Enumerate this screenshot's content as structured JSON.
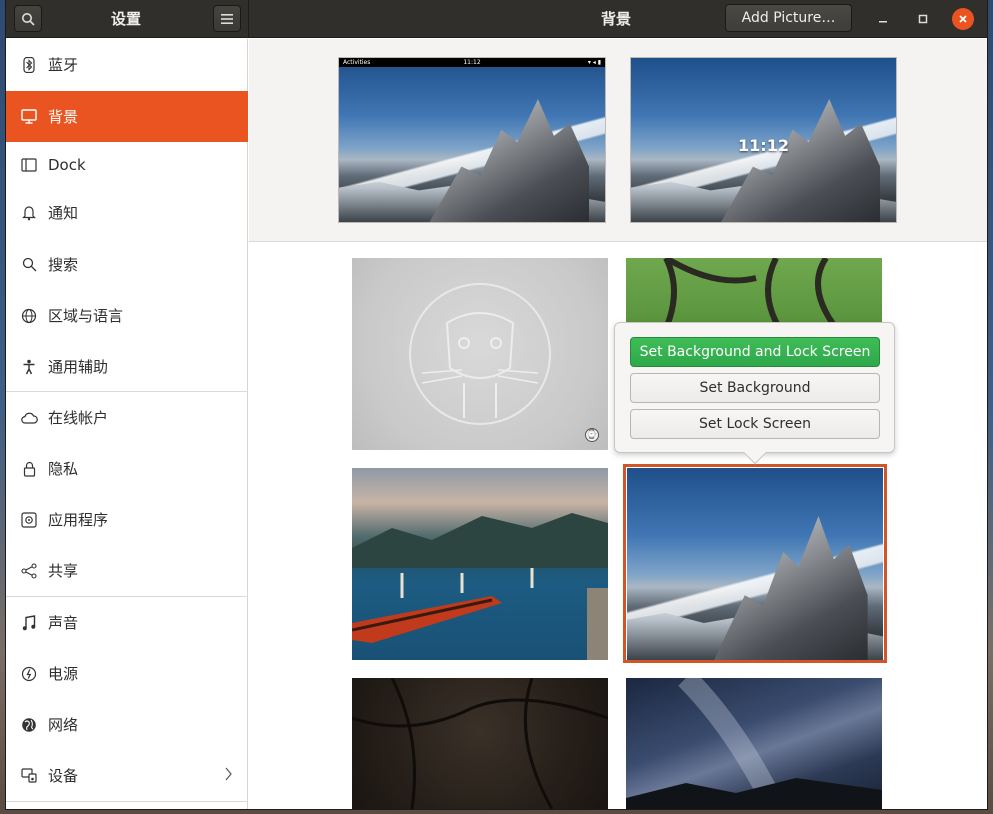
{
  "header": {
    "sidebar_title": "设置",
    "main_title": "背景",
    "add_picture_label": "Add Picture…"
  },
  "sidebar": {
    "items": [
      {
        "label": "蓝牙",
        "icon": "bluetooth-icon"
      },
      {
        "label": "背景",
        "icon": "display-icon",
        "selected": true
      },
      {
        "label": "Dock",
        "icon": "dock-icon"
      },
      {
        "label": "通知",
        "icon": "bell-icon"
      },
      {
        "label": "搜索",
        "icon": "search-icon"
      },
      {
        "label": "区域与语言",
        "icon": "globe-icon"
      },
      {
        "label": "通用辅助",
        "icon": "accessibility-icon"
      },
      {
        "label": "在线帐户",
        "icon": "cloud-icon"
      },
      {
        "label": "隐私",
        "icon": "lock-icon"
      },
      {
        "label": "应用程序",
        "icon": "apps-icon"
      },
      {
        "label": "共享",
        "icon": "share-icon"
      },
      {
        "label": "声音",
        "icon": "music-note-icon"
      },
      {
        "label": "电源",
        "icon": "power-icon"
      },
      {
        "label": "网络",
        "icon": "network-globe-icon"
      },
      {
        "label": "设备",
        "icon": "devices-icon",
        "has_submenu": true
      }
    ]
  },
  "previews": {
    "desktop": {
      "topbar_left": "Activities",
      "topbar_center": "11:12"
    },
    "lock": {
      "clock": "11:12"
    }
  },
  "popover": {
    "set_both": "Set Background and Lock Screen",
    "set_background": "Set Background",
    "set_lock": "Set Lock Screen"
  },
  "colors": {
    "accent": "#e95420",
    "primary_button": "#3fbd57"
  }
}
